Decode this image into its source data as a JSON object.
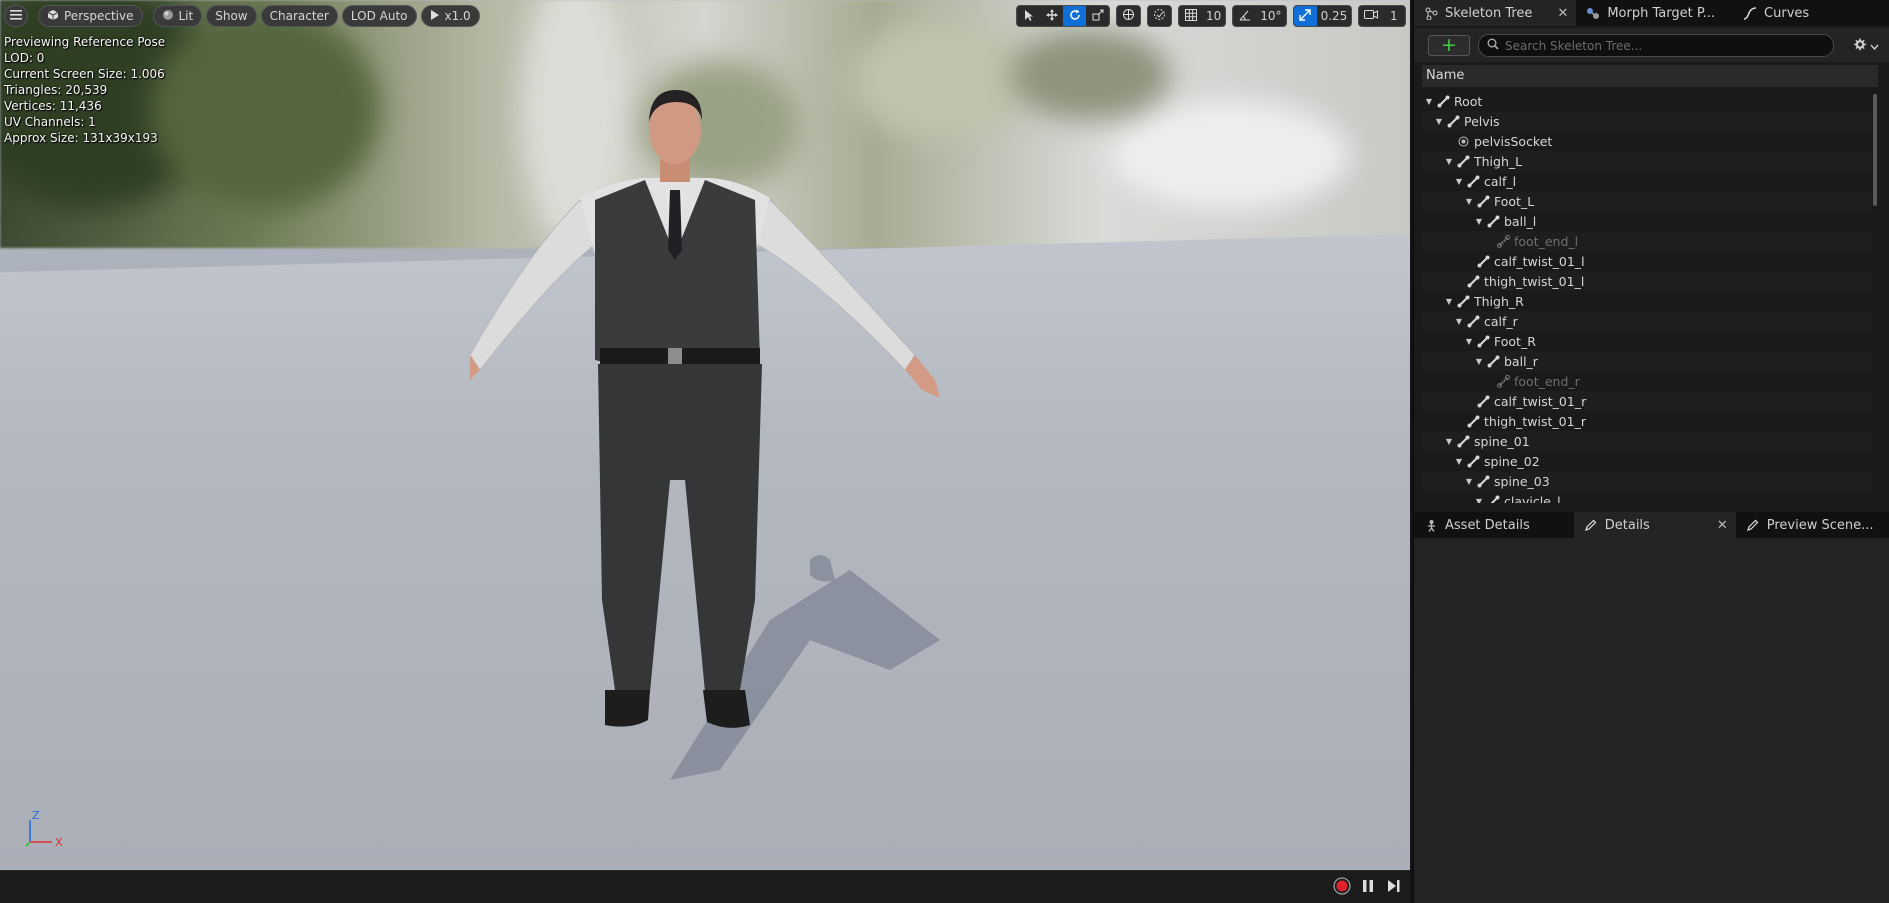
{
  "viewport": {
    "toolbar_left": {
      "view_mode": "Perspective",
      "lighting": "Lit",
      "show": "Show",
      "character": "Character",
      "lod": "LOD Auto",
      "playback_speed": "x1.0"
    },
    "toolbar_right": {
      "grid_snap_value": "10",
      "rotation_snap_value": "10°",
      "scale_snap_value": "0.25",
      "camera_speed": "1"
    },
    "stats": {
      "line1": "Previewing Reference Pose",
      "line2": "LOD: 0",
      "line3": "Current Screen Size: 1.006",
      "line4": "Triangles: 20,539",
      "line5": "Vertices: 11,436",
      "line6": "UV Channels: 1",
      "line7": "Approx Size: 131x39x193"
    },
    "axis": {
      "z": "Z",
      "x": "X"
    }
  },
  "right_panel": {
    "top_tabs": [
      {
        "label": "Skeleton Tree",
        "icon": "skeleton-icon"
      },
      {
        "label": "Morph Target P...",
        "icon": "morph-icon"
      },
      {
        "label": "Curves",
        "icon": "curve-icon"
      }
    ],
    "search_placeholder": "Search Skeleton Tree...",
    "column_header": "Name",
    "tree": [
      {
        "label": "Root",
        "depth": 0,
        "kind": "bone",
        "expanded": true
      },
      {
        "label": "Pelvis",
        "depth": 1,
        "kind": "bone",
        "expanded": true
      },
      {
        "label": "pelvisSocket",
        "depth": 2,
        "kind": "socket",
        "expanded": null
      },
      {
        "label": "Thigh_L",
        "depth": 2,
        "kind": "bone",
        "expanded": true
      },
      {
        "label": "calf_l",
        "depth": 3,
        "kind": "bone",
        "expanded": true
      },
      {
        "label": "Foot_L",
        "depth": 4,
        "kind": "bone",
        "expanded": true
      },
      {
        "label": "ball_l",
        "depth": 5,
        "kind": "bone",
        "expanded": true
      },
      {
        "label": "foot_end_l",
        "depth": 6,
        "kind": "virtual",
        "expanded": null
      },
      {
        "label": "calf_twist_01_l",
        "depth": 4,
        "kind": "bone",
        "expanded": null
      },
      {
        "label": "thigh_twist_01_l",
        "depth": 3,
        "kind": "bone",
        "expanded": null
      },
      {
        "label": "Thigh_R",
        "depth": 2,
        "kind": "bone",
        "expanded": true
      },
      {
        "label": "calf_r",
        "depth": 3,
        "kind": "bone",
        "expanded": true
      },
      {
        "label": "Foot_R",
        "depth": 4,
        "kind": "bone",
        "expanded": true
      },
      {
        "label": "ball_r",
        "depth": 5,
        "kind": "bone",
        "expanded": true
      },
      {
        "label": "foot_end_r",
        "depth": 6,
        "kind": "virtual",
        "expanded": null
      },
      {
        "label": "calf_twist_01_r",
        "depth": 4,
        "kind": "bone",
        "expanded": null
      },
      {
        "label": "thigh_twist_01_r",
        "depth": 3,
        "kind": "bone",
        "expanded": null
      },
      {
        "label": "spine_01",
        "depth": 2,
        "kind": "bone",
        "expanded": true
      },
      {
        "label": "spine_02",
        "depth": 3,
        "kind": "bone",
        "expanded": true
      },
      {
        "label": "spine_03",
        "depth": 4,
        "kind": "bone",
        "expanded": true
      },
      {
        "label": "clavicle_l",
        "depth": 5,
        "kind": "bone",
        "expanded": true
      }
    ],
    "bottom_tabs": [
      {
        "label": "Asset Details",
        "icon": "asset-details-icon"
      },
      {
        "label": "Details",
        "icon": "details-pencil-icon"
      },
      {
        "label": "Preview Scene...",
        "icon": "preview-scene-icon"
      }
    ]
  },
  "colors": {
    "accent_blue": "#0f6fd6",
    "add_green": "#3fce3f",
    "record_red": "#e0202a"
  }
}
